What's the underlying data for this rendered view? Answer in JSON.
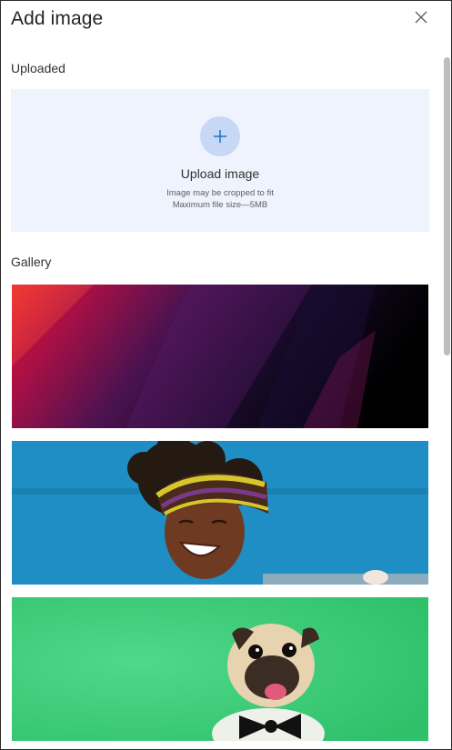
{
  "dialog": {
    "title": "Add image",
    "close_icon": "close-icon"
  },
  "uploaded": {
    "section_label": "Uploaded",
    "upload_title": "Upload image",
    "note_crop": "Image may be cropped to fit",
    "note_size": "Maximum file size—5MB",
    "icon": "plus-icon",
    "accent_color": "#0f6cbd",
    "background_color": "#eef3fd"
  },
  "gallery": {
    "section_label": "Gallery",
    "items": [
      {
        "name": "abstract-gradient-image",
        "colors": [
          "#d4102e",
          "#4a1450",
          "#000000"
        ]
      },
      {
        "name": "smiling-woman-headwrap-image",
        "colors": [
          "#1f8fc4",
          "#2b2118",
          "#c9c12a"
        ]
      },
      {
        "name": "pug-bowtie-image",
        "colors": [
          "#3fcf77",
          "#e9d8b8",
          "#1a1a1a"
        ]
      }
    ]
  }
}
